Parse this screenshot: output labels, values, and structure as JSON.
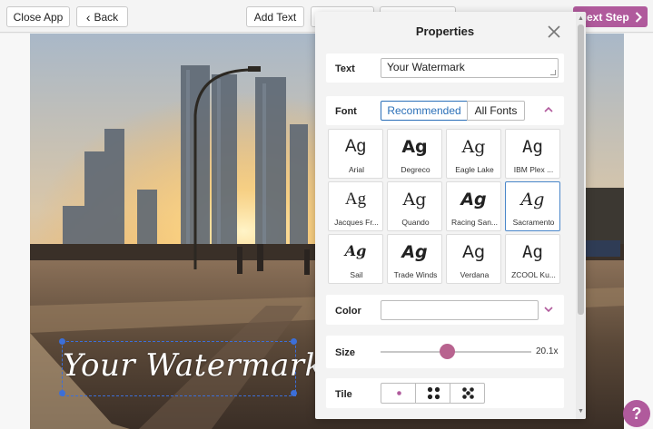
{
  "toolbar": {
    "close_app_label": "Close App",
    "back_label": "Back",
    "add_text_label": "Add Text",
    "next_step_label": "Next Step",
    "accent_color": "#b05a9c"
  },
  "canvas": {
    "watermark_text": "Your Watermark"
  },
  "properties": {
    "title": "Properties",
    "text": {
      "label": "Text",
      "value": "Your Watermark"
    },
    "font": {
      "label": "Font",
      "tabs": [
        {
          "label": "Recommended",
          "active": true
        },
        {
          "label": "All Fonts",
          "active": false
        }
      ],
      "tiles": [
        {
          "sample": "Ag",
          "name": "Arial"
        },
        {
          "sample": "Ag",
          "name": "Degreco"
        },
        {
          "sample": "Ag",
          "name": "Eagle Lake"
        },
        {
          "sample": "Ag",
          "name": "IBM Plex ..."
        },
        {
          "sample": "Ag",
          "name": "Jacques Fr..."
        },
        {
          "sample": "Ag",
          "name": "Quando"
        },
        {
          "sample": "Ag",
          "name": "Racing San..."
        },
        {
          "sample": "Ag",
          "name": "Sacramento"
        },
        {
          "sample": "Ag",
          "name": "Sail"
        },
        {
          "sample": "Ag",
          "name": "Trade Winds"
        },
        {
          "sample": "Ag",
          "name": "Verdana"
        },
        {
          "sample": "Ag",
          "name": "ZCOOL Ku..."
        }
      ],
      "selected": "Sacramento"
    },
    "color": {
      "label": "Color",
      "value": ""
    },
    "size": {
      "label": "Size",
      "value_text": "20.1x",
      "slider_fraction": 0.44
    },
    "tile": {
      "label": "Tile",
      "options": [
        "single-dot-icon",
        "four-dots-icon",
        "five-dots-icon"
      ],
      "selected_index": 0
    }
  },
  "help": {
    "label": "?"
  }
}
